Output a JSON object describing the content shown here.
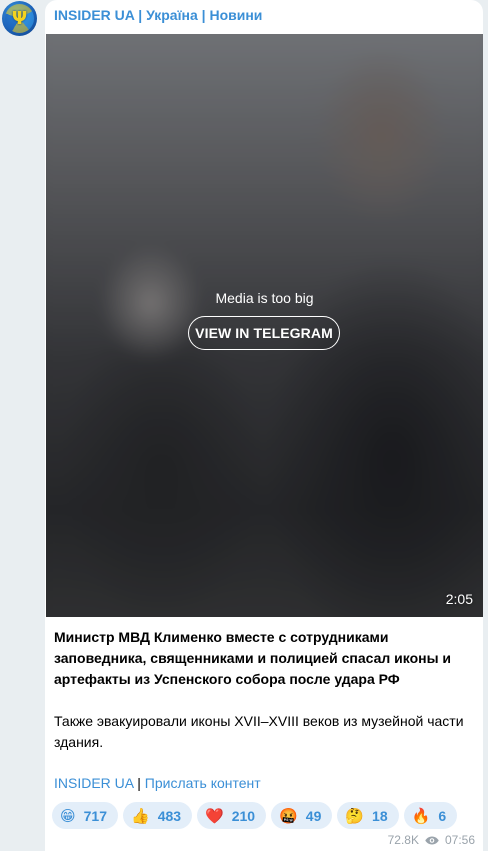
{
  "channel": {
    "title": "INSIDER UA | Україна | Новини",
    "avatar_icon": "trident-icon"
  },
  "media": {
    "message": "Media is too big",
    "button_label": "VIEW IN TELEGRAM",
    "duration": "2:05"
  },
  "post": {
    "headline": "Министр МВД Клименко вместе с сотрудниками заповедника, священниками и полицией спасал иконы и артефакты из Успенского собора после удара РФ",
    "body": "Также эвакуировали иконы XVII–XVIII веков из музейной части здания.",
    "link_channel": "INSIDER UA",
    "separator": "|",
    "link_submit": "Прислать контент"
  },
  "reactions": [
    {
      "emoji": "😁",
      "icon": "grin-emoji-icon",
      "count": "717"
    },
    {
      "emoji": "👍",
      "icon": "thumbs-up-icon",
      "count": "483"
    },
    {
      "emoji": "❤️",
      "icon": "heart-icon",
      "count": "210"
    },
    {
      "emoji": "🤬",
      "icon": "angry-face-icon",
      "count": "49"
    },
    {
      "emoji": "🤔",
      "icon": "thinking-face-icon",
      "count": "18"
    },
    {
      "emoji": "🔥",
      "icon": "fire-icon",
      "count": "6"
    }
  ],
  "meta": {
    "views": "72.8K",
    "time": "07:56",
    "views_icon": "eye-icon"
  },
  "colors": {
    "accent": "#3b8fd6",
    "reaction_bg": "#e3eef9",
    "page_bg": "#e9eef1"
  }
}
